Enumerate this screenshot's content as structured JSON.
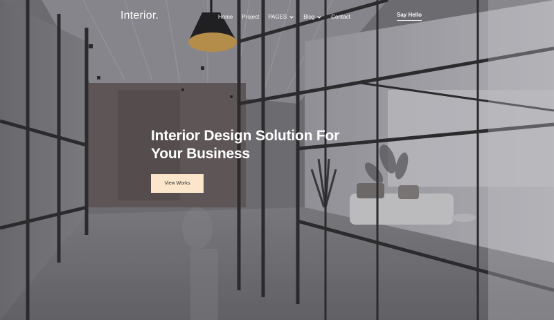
{
  "brand": {
    "logo": "Interior."
  },
  "nav": {
    "items": [
      {
        "label": "Home",
        "has_dropdown": false
      },
      {
        "label": "Project",
        "has_dropdown": false
      },
      {
        "label": "PAGES",
        "has_dropdown": true
      },
      {
        "label": "Blog",
        "has_dropdown": true
      },
      {
        "label": "Contact",
        "has_dropdown": false
      }
    ],
    "cta": "Say Hello"
  },
  "hero": {
    "title": "Interior Design Solution For Your Business",
    "button": "View Works"
  },
  "colors": {
    "accent_button": "#fbe6cc",
    "text": "#ffffff"
  }
}
